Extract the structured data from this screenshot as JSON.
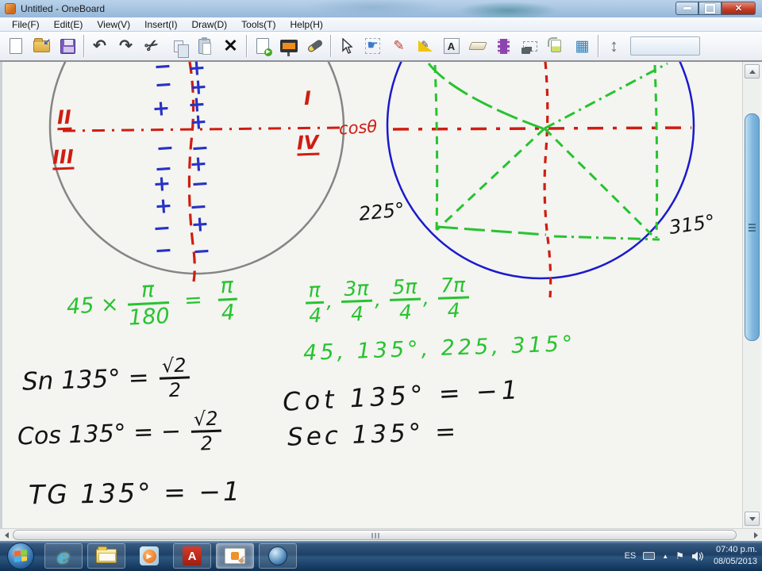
{
  "window": {
    "title": "Untitled - OneBoard",
    "controls": [
      "minimize",
      "maximize",
      "close"
    ]
  },
  "menu": {
    "items": [
      "File(F)",
      "Edit(E)",
      "View(V)",
      "Insert(I)",
      "Draw(D)",
      "Tools(T)",
      "Help(H)"
    ]
  },
  "toolbar": {
    "icons": [
      "new-page-icon",
      "open-folder-icon",
      "save-floppy-icon",
      "undo-icon",
      "redo-icon",
      "cut-icon",
      "copy-icon",
      "paste-icon",
      "delete-icon",
      "export-icon",
      "board-show-icon",
      "spotlight-icon",
      "select-cursor-icon",
      "hand-select-icon",
      "pen-icon",
      "geometry-icon",
      "text-icon",
      "eraser-icon",
      "video-icon",
      "screenshot-icon",
      "lamp-icon",
      "grid-icon",
      "expand-icon"
    ],
    "glyphs": {
      "undo": "↶",
      "redo": "↷",
      "cut": "✂",
      "delete": "✕",
      "run": "▶",
      "hand": "☛",
      "pen": "✎",
      "text_label": "A",
      "grid": "▦",
      "expand": "↕"
    }
  },
  "punct": {
    "comma": ",",
    "times": "×",
    "equals": "="
  },
  "canvas": {
    "left_circle": {
      "quadrants": {
        "q1": "I",
        "q2": "II",
        "q3": "III",
        "q4": "IV"
      },
      "axis_label": "cosθ"
    },
    "right_circle": {
      "angle_labels": {
        "a225": "225°",
        "a315": "315°"
      }
    },
    "sign_marks": [
      [
        202,
        84,
        "−"
      ],
      [
        203,
        107,
        "−"
      ],
      [
        200,
        137,
        "+"
      ],
      [
        205,
        187,
        "−"
      ],
      [
        203,
        213,
        "−"
      ],
      [
        201,
        232,
        "+"
      ],
      [
        203,
        260,
        "+"
      ],
      [
        201,
        288,
        "−"
      ],
      [
        203,
        316,
        "−"
      ],
      [
        245,
        86,
        "+"
      ],
      [
        247,
        110,
        "+"
      ],
      [
        245,
        132,
        "+"
      ],
      [
        247,
        154,
        "+"
      ],
      [
        249,
        187,
        "−"
      ],
      [
        247,
        207,
        "+"
      ],
      [
        249,
        232,
        "−"
      ],
      [
        247,
        261,
        "−"
      ],
      [
        249,
        283,
        "+"
      ],
      [
        251,
        317,
        "−"
      ]
    ],
    "notes": {
      "conversion": {
        "lhs": "45",
        "num1": "π",
        "den1": "180",
        "num2": "π",
        "den2": "4"
      },
      "fracs": [
        {
          "n": "π",
          "d": "4"
        },
        {
          "n": "3π",
          "d": "4"
        },
        {
          "n": "5π",
          "d": "4"
        },
        {
          "n": "7π",
          "d": "4"
        }
      ],
      "degrees_row": "45, 135°, 225, 315°",
      "sin": {
        "lhs": "Sn 135° =",
        "num": "√2",
        "den": "2"
      },
      "cos": {
        "lhs": "Cos 135° = −",
        "num": "√2",
        "den": "2"
      },
      "tan": "TG 135° = −1",
      "cot": "Cot 135° = −1",
      "sec": "Sec 135° ="
    },
    "ink_colors": {
      "red": "#cf1d10",
      "blue": "#2633c4",
      "green": "#27c32f",
      "black": "#141414",
      "gray_circle": "#858585",
      "blue_circle": "#1a1acc"
    }
  },
  "taskbar": {
    "apps": [
      "start-orb",
      "internet-explorer",
      "windows-explorer",
      "media-player",
      "adobe-reader",
      "oneboard",
      "sphere-app"
    ],
    "tray": {
      "language": "ES",
      "time": "07:40 p.m.",
      "date": "08/05/2013"
    }
  }
}
